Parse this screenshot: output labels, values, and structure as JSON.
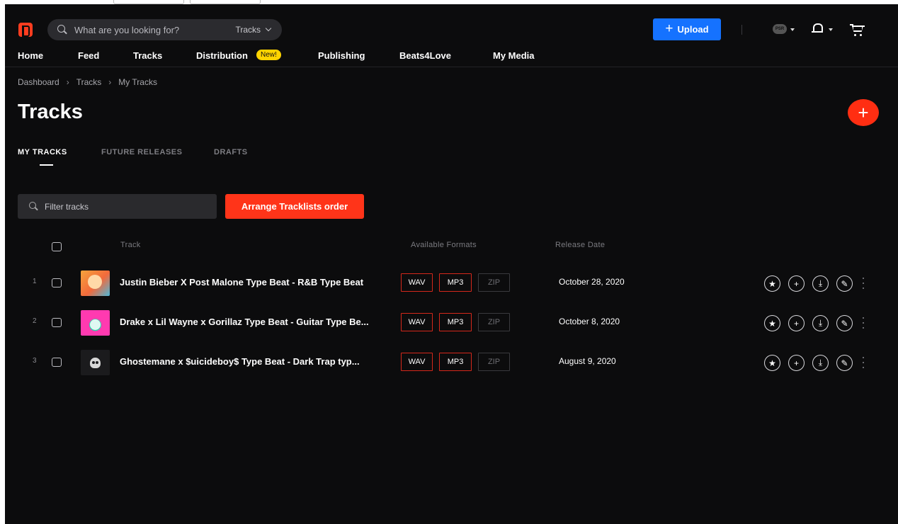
{
  "search": {
    "placeholder": "What are you looking for?",
    "scope": "Tracks"
  },
  "header": {
    "upload_label": "Upload",
    "avatar_text": "PSR"
  },
  "nav": {
    "items": [
      "Home",
      "Feed",
      "Tracks",
      "Distribution",
      "Publishing",
      "Beats4Love",
      "My Media"
    ],
    "new_badge": "New!"
  },
  "breadcrumb": [
    "Dashboard",
    "Tracks",
    "My Tracks"
  ],
  "page": {
    "title": "Tracks",
    "tabs": [
      "MY TRACKS",
      "FUTURE RELEASES",
      "DRAFTS"
    ],
    "active_tab": "MY TRACKS"
  },
  "toolbar": {
    "filter_placeholder": "Filter tracks",
    "arrange_label": "Arrange Tracklists order"
  },
  "table": {
    "columns": [
      "Track",
      "Available Formats",
      "Release Date"
    ],
    "rows": [
      {
        "num": "1",
        "title": "Justin Bieber X Post Malone Type Beat - R&B Type Beat",
        "formats": [
          "WAV",
          "MP3",
          "ZIP"
        ],
        "date": "October 28, 2020"
      },
      {
        "num": "2",
        "title": "Drake x Lil Wayne x Gorillaz Type Beat - Guitar Type Be...",
        "formats": [
          "WAV",
          "MP3",
          "ZIP"
        ],
        "date": "October 8, 2020"
      },
      {
        "num": "3",
        "title": "Ghostemane x $uicideboy$ Type Beat - Dark Trap typ...",
        "formats": [
          "WAV",
          "MP3",
          "ZIP"
        ],
        "date": "August 9, 2020"
      }
    ]
  },
  "colors": {
    "background": "#0c0c0d",
    "accent_red": "#ff3419",
    "upload_blue": "#1572ff",
    "badge_yellow": "#ffd400"
  },
  "icons": {
    "row_actions": [
      "star-icon",
      "plus-icon",
      "download-icon",
      "pencil-icon",
      "more-vertical-icon"
    ]
  }
}
